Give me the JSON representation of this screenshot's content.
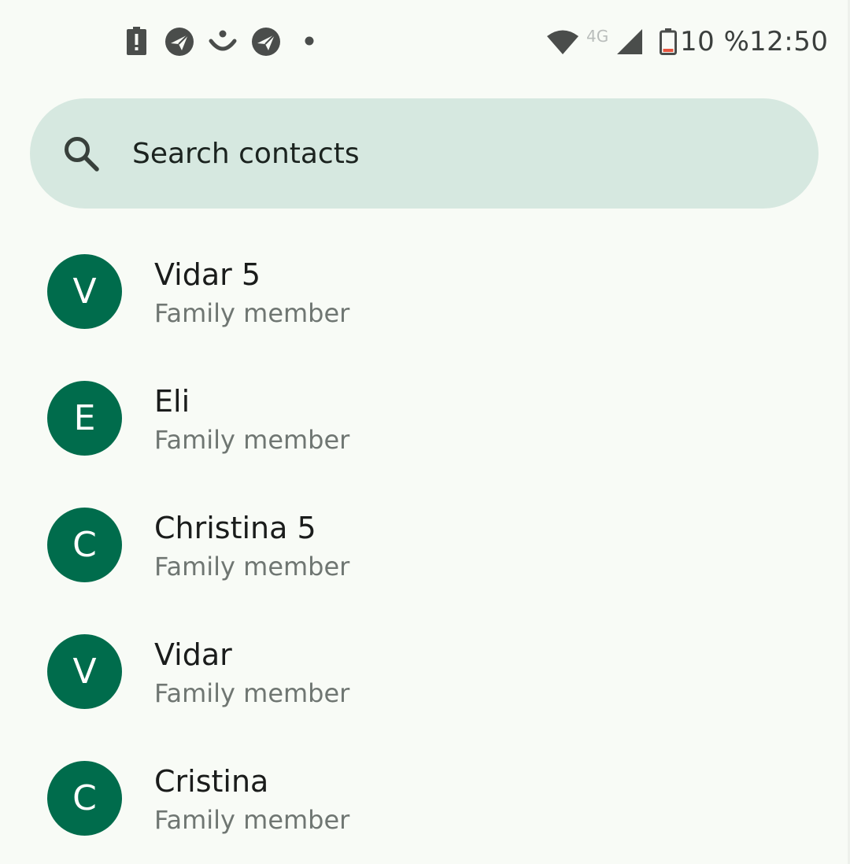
{
  "status_bar": {
    "network_type": "4G",
    "battery_percent": "10 %",
    "time": "12:50",
    "battery_level": 0.1,
    "icons": [
      "battery-alert-icon",
      "app-notification-icon",
      "smile-notification-icon",
      "app-notification-icon",
      "more-notifications-dot-icon",
      "wifi-icon",
      "cell-signal-icon",
      "battery-icon"
    ]
  },
  "search": {
    "placeholder": "Search contacts"
  },
  "contacts": [
    {
      "initial": "V",
      "name": "Vidar 5",
      "relation": "Family member"
    },
    {
      "initial": "E",
      "name": "Eli",
      "relation": "Family member"
    },
    {
      "initial": "C",
      "name": "Christina 5",
      "relation": "Family member"
    },
    {
      "initial": "V",
      "name": "Vidar",
      "relation": "Family member"
    },
    {
      "initial": "C",
      "name": "Cristina",
      "relation": "Family member"
    }
  ],
  "colors": {
    "background": "#f8fbf6",
    "search_background": "#d6e8e0",
    "avatar": "#006c4c",
    "secondary_text": "#6f7672"
  }
}
